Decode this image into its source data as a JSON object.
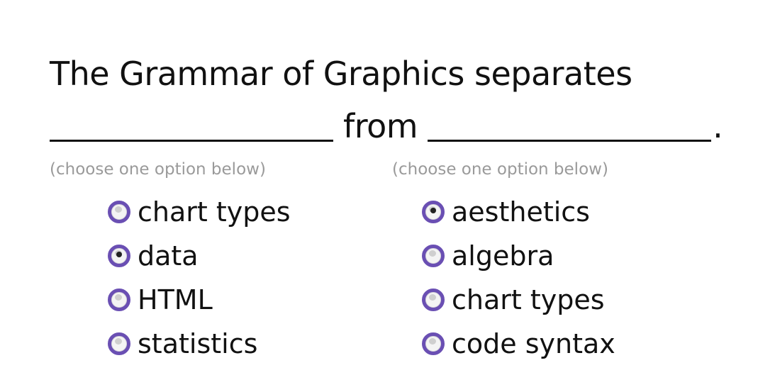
{
  "question": {
    "line1": "The Grammar of Graphics separates",
    "from_word": "from",
    "period": "."
  },
  "left_group": {
    "hint": "(choose one option below)",
    "options": [
      {
        "label": "chart types",
        "selected": false
      },
      {
        "label": "data",
        "selected": true
      },
      {
        "label": "HTML",
        "selected": false
      },
      {
        "label": "statistics",
        "selected": false
      }
    ]
  },
  "right_group": {
    "hint": "(choose one option below)",
    "options": [
      {
        "label": "aesthetics",
        "selected": true
      },
      {
        "label": "algebra",
        "selected": false
      },
      {
        "label": "chart types",
        "selected": false
      },
      {
        "label": "code syntax",
        "selected": false
      }
    ]
  },
  "colors": {
    "radio_ring": "#6a4fb3",
    "hint_text": "#9a9a9a",
    "body_text": "#111111"
  }
}
